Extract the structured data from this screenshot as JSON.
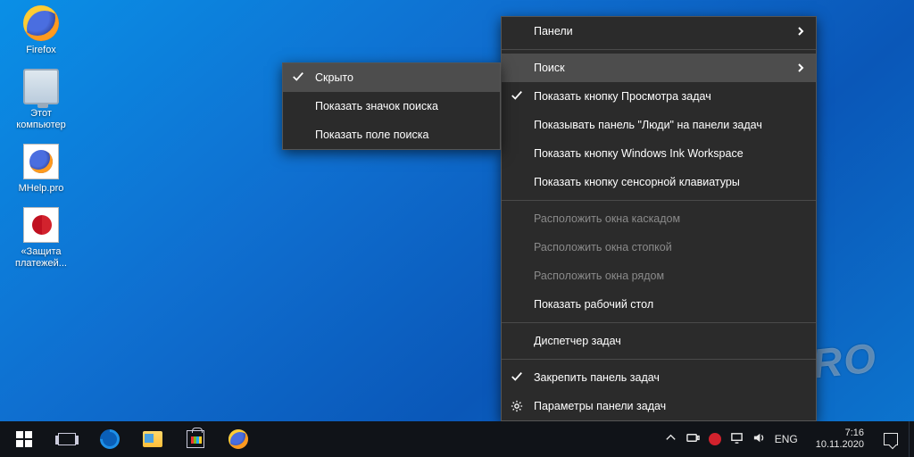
{
  "desktop_icons": [
    {
      "id": "firefox",
      "label": "Firefox"
    },
    {
      "id": "this-pc",
      "label": "Этот\nкомпьютер"
    },
    {
      "id": "mhelp",
      "label": "MHelp.pro"
    },
    {
      "id": "pay-protect",
      "label": "«Защита\nплатежей..."
    }
  ],
  "submenu": {
    "items": [
      {
        "id": "hidden",
        "label": "Скрыто",
        "checked": true,
        "highlight": true
      },
      {
        "id": "show-search-icon",
        "label": "Показать значок поиска"
      },
      {
        "id": "show-search-box",
        "label": "Показать поле поиска"
      }
    ]
  },
  "menu": {
    "items": [
      {
        "id": "toolbars",
        "label": "Панели",
        "submenu": true
      },
      {
        "sep": true
      },
      {
        "id": "search",
        "label": "Поиск",
        "submenu": true,
        "highlight": true
      },
      {
        "id": "show-taskview",
        "label": "Показать кнопку Просмотра задач",
        "checked": true
      },
      {
        "id": "show-people",
        "label": "Показывать панель \"Люди\" на панели задач"
      },
      {
        "id": "show-ink",
        "label": "Показать кнопку Windows Ink Workspace"
      },
      {
        "id": "show-touchkb",
        "label": "Показать кнопку сенсорной клавиатуры"
      },
      {
        "sep": true
      },
      {
        "id": "cascade",
        "label": "Расположить окна каскадом",
        "disabled": true
      },
      {
        "id": "stacked",
        "label": "Расположить окна стопкой",
        "disabled": true
      },
      {
        "id": "sidebyside",
        "label": "Расположить окна рядом",
        "disabled": true
      },
      {
        "id": "show-desktop",
        "label": "Показать рабочий стол"
      },
      {
        "sep": true
      },
      {
        "id": "task-manager",
        "label": "Диспетчер задач"
      },
      {
        "sep": true
      },
      {
        "id": "lock-taskbar",
        "label": "Закрепить панель задач",
        "checked": true
      },
      {
        "id": "taskbar-settings",
        "label": "Параметры панели задач",
        "gear": true
      }
    ]
  },
  "taskbar": {
    "lang": "ENG",
    "time": "7:16",
    "date": "10.11.2020"
  },
  "watermark": "MHELP.PRO"
}
